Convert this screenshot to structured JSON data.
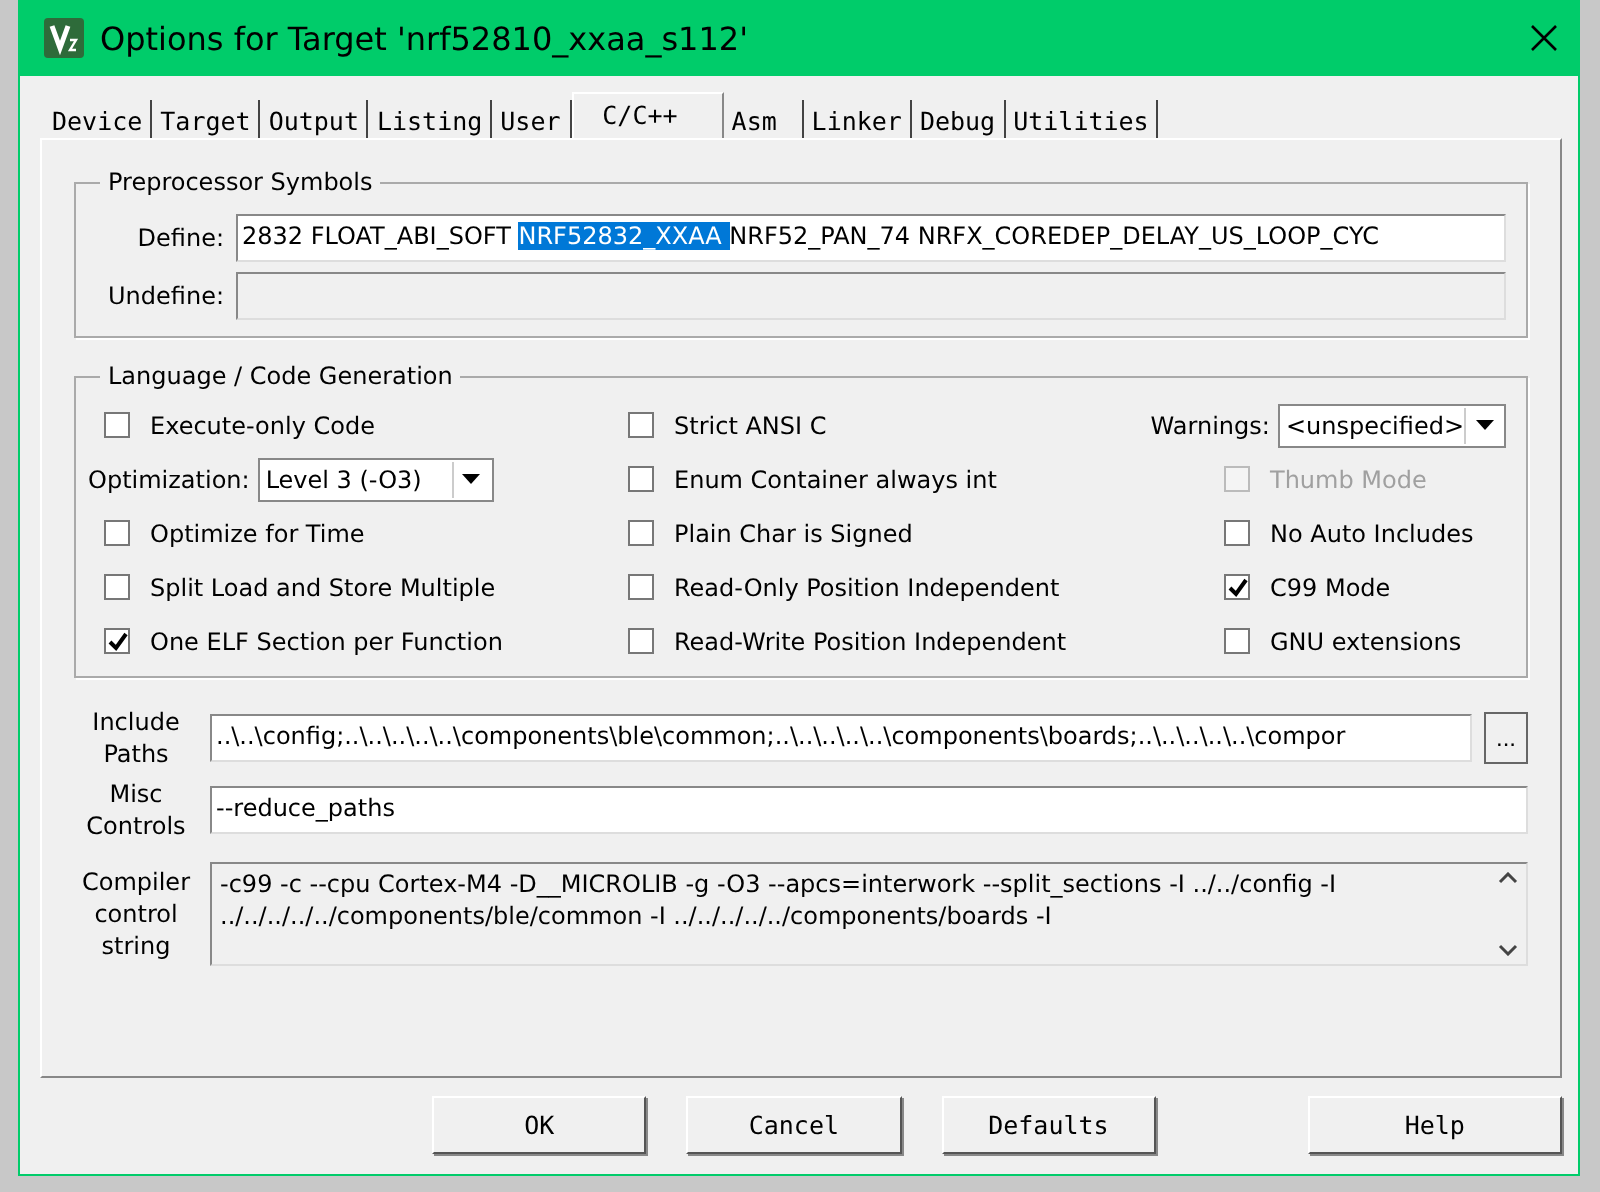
{
  "window": {
    "title": "Options for Target 'nrf52810_xxaa_s112'"
  },
  "tabs": [
    {
      "label": "Device",
      "selected": false
    },
    {
      "label": "Target",
      "selected": false
    },
    {
      "label": "Output",
      "selected": false
    },
    {
      "label": "Listing",
      "selected": false
    },
    {
      "label": "User",
      "selected": false
    },
    {
      "label": "C/C++",
      "selected": true
    },
    {
      "label": "Asm",
      "selected": false
    },
    {
      "label": "Linker",
      "selected": false
    },
    {
      "label": "Debug",
      "selected": false
    },
    {
      "label": "Utilities",
      "selected": false
    }
  ],
  "preprocessor": {
    "title": "Preprocessor Symbols",
    "define": {
      "label": "Define:",
      "value_parts": [
        {
          "text": "2832 FLOAT_ABI_SOFT ",
          "selected": false
        },
        {
          "text": "NRF52832_XXAA ",
          "selected": true
        },
        {
          "text": "NRF52_PAN_74 NRFX_COREDEP_DELAY_US_LOOP_CYC",
          "selected": false
        }
      ]
    },
    "undefine": {
      "label": "Undefine:",
      "disabled": true
    }
  },
  "language": {
    "title": "Language / Code Generation",
    "columns": [
      [
        {
          "kind": "checkbox",
          "label": "Execute-only Code",
          "checked": false,
          "disabled": false
        },
        {
          "kind": "select",
          "label": "Optimization:",
          "value": "Level 3 (-O3)"
        },
        {
          "kind": "checkbox",
          "label": "Optimize for Time",
          "checked": false,
          "disabled": false
        },
        {
          "kind": "checkbox",
          "label": "Split Load and Store Multiple",
          "checked": false,
          "disabled": false
        },
        {
          "kind": "checkbox",
          "label": "One ELF Section per Function",
          "checked": true,
          "disabled": false
        }
      ],
      [
        {
          "kind": "checkbox",
          "label": "Strict ANSI C",
          "checked": false,
          "disabled": false
        },
        {
          "kind": "checkbox",
          "label": "Enum Container always int",
          "checked": false,
          "disabled": false
        },
        {
          "kind": "checkbox",
          "label": "Plain Char is Signed",
          "checked": false,
          "disabled": false
        },
        {
          "kind": "checkbox",
          "label": "Read-Only Position Independent",
          "checked": false,
          "disabled": false
        },
        {
          "kind": "checkbox",
          "label": "Read-Write Position Independent",
          "checked": false,
          "disabled": false
        }
      ],
      [
        {
          "kind": "select",
          "label": "Warnings:",
          "value": "<unspecified>"
        },
        {
          "kind": "checkbox",
          "label": "Thumb Mode",
          "checked": false,
          "disabled": true
        },
        {
          "kind": "checkbox",
          "label": "No Auto Includes",
          "checked": false,
          "disabled": false
        },
        {
          "kind": "checkbox",
          "label": "C99 Mode",
          "checked": true,
          "disabled": false
        },
        {
          "kind": "checkbox",
          "label": "GNU extensions",
          "checked": false,
          "disabled": false
        }
      ]
    ]
  },
  "include_paths": {
    "label_lines": [
      "Include",
      "Paths"
    ],
    "value": "..\\..\\config;..\\..\\..\\..\\..\\components\\ble\\common;..\\..\\..\\..\\..\\components\\boards;..\\..\\..\\..\\..\\compor",
    "browse": "..."
  },
  "misc_controls": {
    "label_lines": [
      "Misc",
      "Controls"
    ],
    "value": "--reduce_paths"
  },
  "compiler_string": {
    "label_lines": [
      "Compiler",
      "control",
      "string"
    ],
    "lines": [
      "-c99 -c --cpu Cortex-M4 -D__MICROLIB -g -O3 --apcs=interwork --split_sections -I ../../config -I",
      "../../../../../components/ble/common -I ../../../../../components/boards -I"
    ]
  },
  "buttons": [
    "OK",
    "Cancel",
    "Defaults",
    "Help"
  ]
}
